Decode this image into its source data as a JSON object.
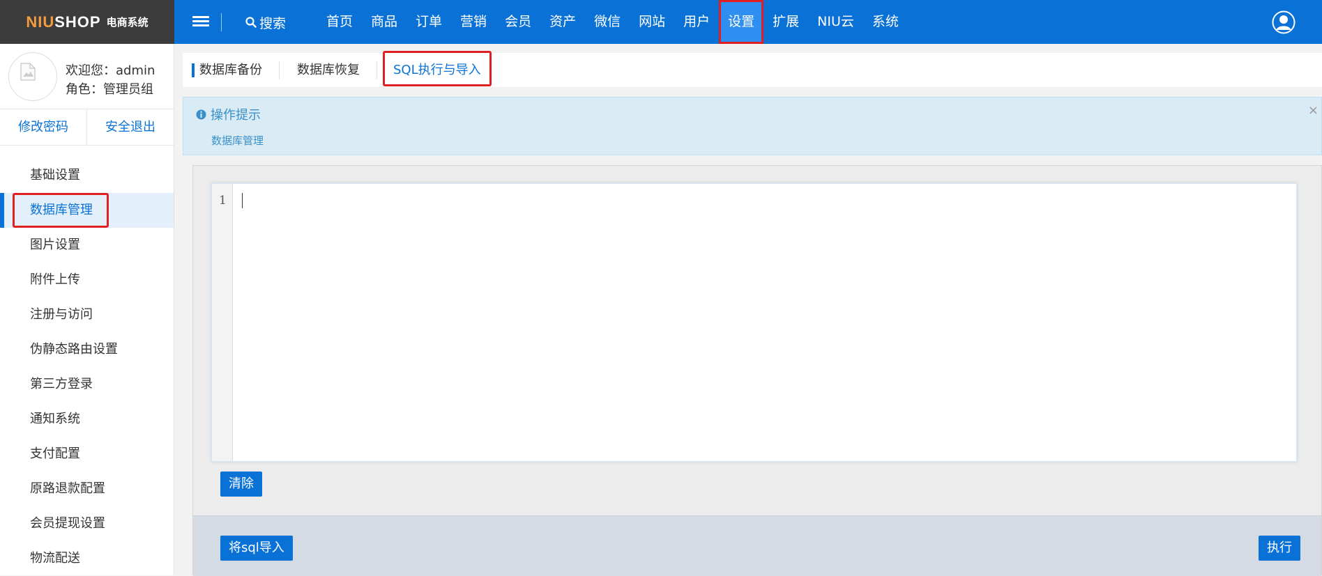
{
  "header": {
    "logo_brand_a": "NIU",
    "logo_brand_b": "SHOP",
    "logo_sub": "电商系统",
    "search_label": "搜索",
    "nav": [
      "首页",
      "商品",
      "订单",
      "营销",
      "会员",
      "资产",
      "微信",
      "网站",
      "用户",
      "设置",
      "扩展",
      "NIU云",
      "系统"
    ],
    "active_nav": "设置",
    "colors": {
      "primary": "#0a72d6",
      "logo_bg": "#3c3c3c",
      "highlight": "#e02020"
    }
  },
  "profile": {
    "welcome": "欢迎您：admin",
    "role": "角色：管理员组",
    "change_password": "修改密码",
    "logout": "安全退出"
  },
  "sidebar": {
    "items": [
      "基础设置",
      "数据库管理",
      "图片设置",
      "附件上传",
      "注册与访问",
      "伪静态路由设置",
      "第三方登录",
      "通知系统",
      "支付配置",
      "原路退款配置",
      "会员提现设置",
      "物流配送"
    ],
    "active": "数据库管理"
  },
  "tabs": {
    "items": [
      "数据库备份",
      "数据库恢复",
      "SQL执行与导入"
    ],
    "active": "SQL执行与导入"
  },
  "tips": {
    "title": "操作提示",
    "body": "数据库管理",
    "close": "×"
  },
  "editor": {
    "line_number": "1",
    "content": ""
  },
  "buttons": {
    "clear": "清除",
    "import": "将sql导入",
    "execute": "执行"
  }
}
